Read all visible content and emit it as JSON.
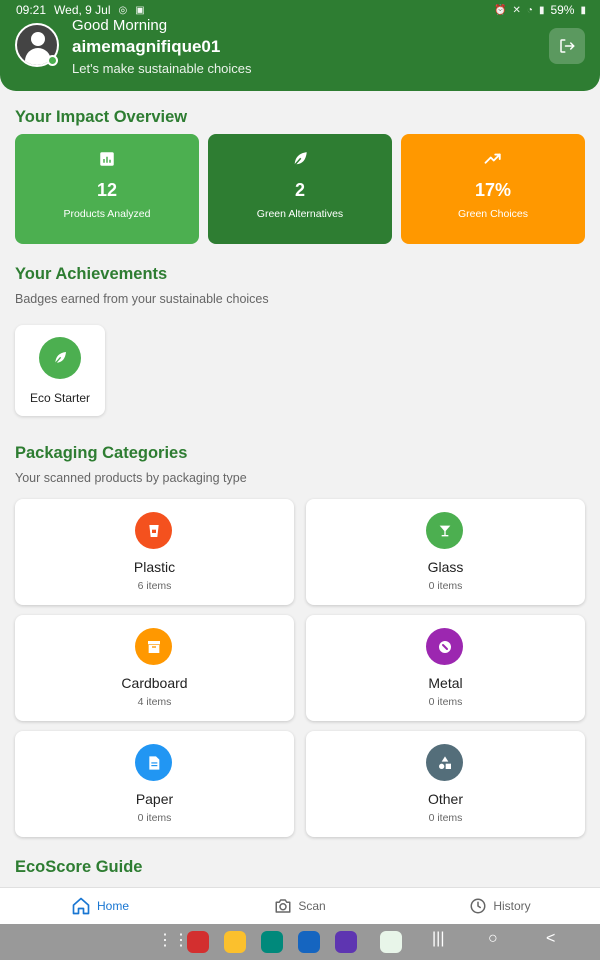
{
  "status_bar": {
    "time": "09:21",
    "date": "Wed, 9 Jul",
    "battery": "59%"
  },
  "header": {
    "greeting": "Good Morning",
    "username": "aimemagnifique01",
    "tagline": "Let's make sustainable choices"
  },
  "impact": {
    "title": "Your Impact Overview",
    "cards": [
      {
        "value": "12",
        "label": "Products Analyzed",
        "icon": "bar-chart-icon",
        "color": "#4caf50"
      },
      {
        "value": "2",
        "label": "Green Alternatives",
        "icon": "leaf-icon",
        "color": "#2e7d32"
      },
      {
        "value": "17%",
        "label": "Green Choices",
        "icon": "trending-up-icon",
        "color": "#ff9800"
      }
    ]
  },
  "achievements": {
    "title": "Your Achievements",
    "subtitle": "Badges earned from your sustainable choices",
    "badges": [
      {
        "label": "Eco Starter",
        "icon": "leaf-icon"
      }
    ]
  },
  "packaging": {
    "title": "Packaging Categories",
    "subtitle": "Your scanned products by packaging type",
    "categories": [
      {
        "name": "Plastic",
        "count": "6 items",
        "color": "#f4511e",
        "icon": "cup-icon"
      },
      {
        "name": "Glass",
        "count": "0 items",
        "color": "#4caf50",
        "icon": "glass-icon"
      },
      {
        "name": "Cardboard",
        "count": "4 items",
        "color": "#ff9800",
        "icon": "box-icon"
      },
      {
        "name": "Metal",
        "count": "0 items",
        "color": "#9c27b0",
        "icon": "metal-icon"
      },
      {
        "name": "Paper",
        "count": "0 items",
        "color": "#2196f3",
        "icon": "document-icon"
      },
      {
        "name": "Other",
        "count": "0 items",
        "color": "#546e7a",
        "icon": "shapes-icon"
      }
    ]
  },
  "ecoscore": {
    "title": "EcoScore Guide"
  },
  "bottom_nav": {
    "items": [
      {
        "label": "Home",
        "icon": "home-icon",
        "active": true
      },
      {
        "label": "Scan",
        "icon": "camera-icon",
        "active": false
      },
      {
        "label": "History",
        "icon": "clock-icon",
        "active": false
      }
    ]
  },
  "colors": {
    "primary": "#2e7d32",
    "accent": "#1976d2"
  }
}
